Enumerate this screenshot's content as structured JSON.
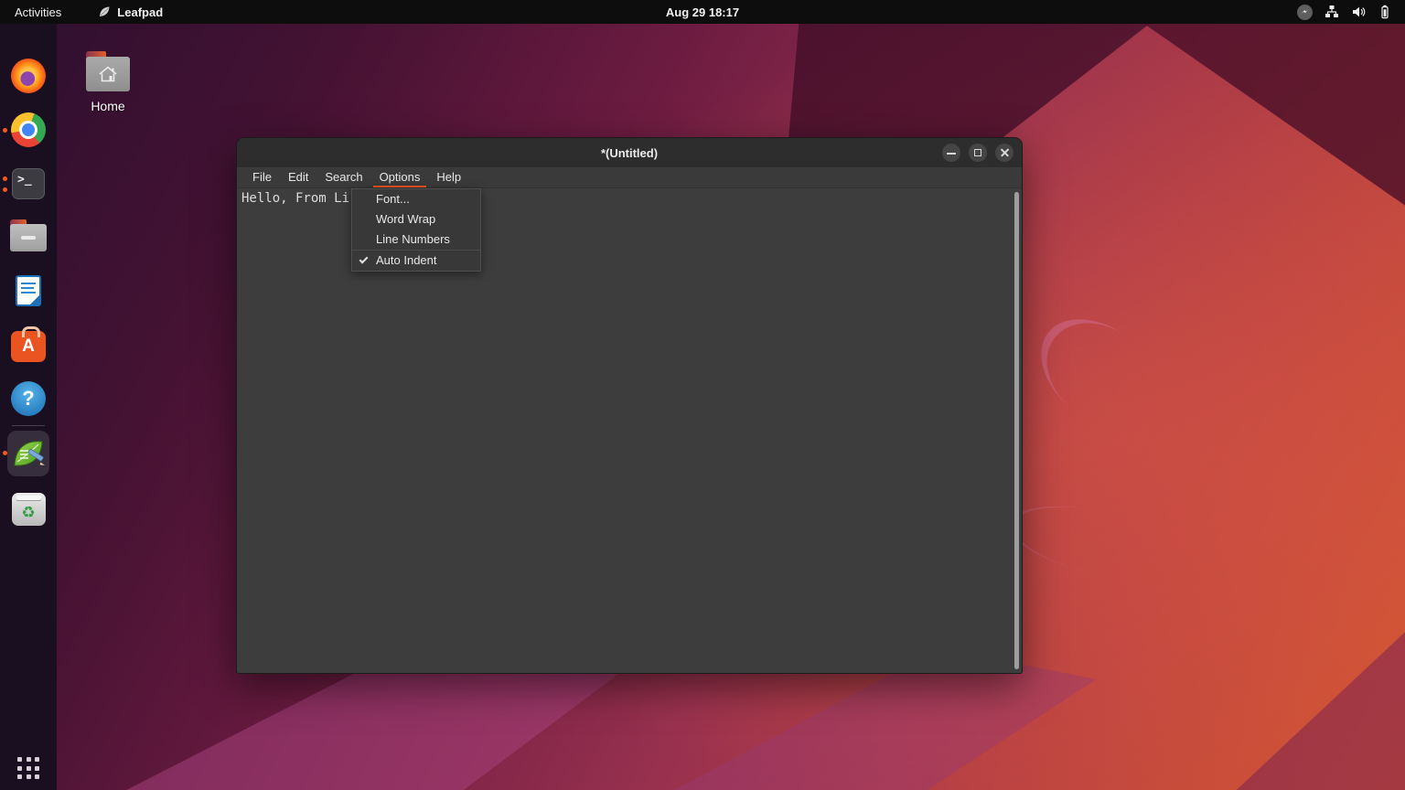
{
  "topbar": {
    "activities_label": "Activities",
    "focused_app": "Leafpad",
    "clock": "Aug 29 18:17",
    "tray_icons": [
      "messenger-icon",
      "wired-network-icon",
      "volume-icon",
      "battery-icon"
    ]
  },
  "desktop": {
    "icons": [
      {
        "label": "Home",
        "icon": "home-folder-icon"
      }
    ]
  },
  "dock": {
    "items": [
      {
        "icon": "firefox-icon",
        "running_dots": 0
      },
      {
        "icon": "chrome-icon",
        "running_dots": 1
      },
      {
        "icon": "terminal-icon",
        "running_dots": 2,
        "glyph": ">_"
      },
      {
        "icon": "files-icon",
        "running_dots": 0
      },
      {
        "icon": "libreoffice-writer-icon",
        "running_dots": 0
      },
      {
        "icon": "ubuntu-software-icon",
        "running_dots": 0,
        "glyph": "A"
      },
      {
        "icon": "help-icon",
        "running_dots": 0,
        "glyph": "?"
      },
      {
        "icon": "leafpad-icon",
        "running_dots": 1,
        "active": true
      },
      {
        "icon": "trash-icon",
        "running_dots": 0,
        "glyph": "♻"
      }
    ],
    "show_apps_icon": "show-applications-grid"
  },
  "window": {
    "title": "*(Untitled)",
    "menubar": {
      "items": [
        {
          "label": "File"
        },
        {
          "label": "Edit"
        },
        {
          "label": "Search"
        },
        {
          "label": "Options",
          "active": true
        },
        {
          "label": "Help"
        }
      ]
    },
    "options_menu": {
      "items": [
        {
          "label": "Font...",
          "checked": false
        },
        {
          "label": "Word Wrap",
          "checked": false
        },
        {
          "label": "Line Numbers",
          "checked": false
        },
        {
          "label": "Auto Indent",
          "checked": true
        }
      ]
    },
    "editor_text": "Hello, From Li"
  },
  "colors": {
    "accent_orange": "#E95420",
    "topbar_bg": "#0D0D0D",
    "dock_bg": "#190F20",
    "titlebar_bg": "#2D2D2D",
    "menubar_bg": "#3A3A3A",
    "editor_bg": "#3D3D3D",
    "menu_bg": "#383838"
  }
}
